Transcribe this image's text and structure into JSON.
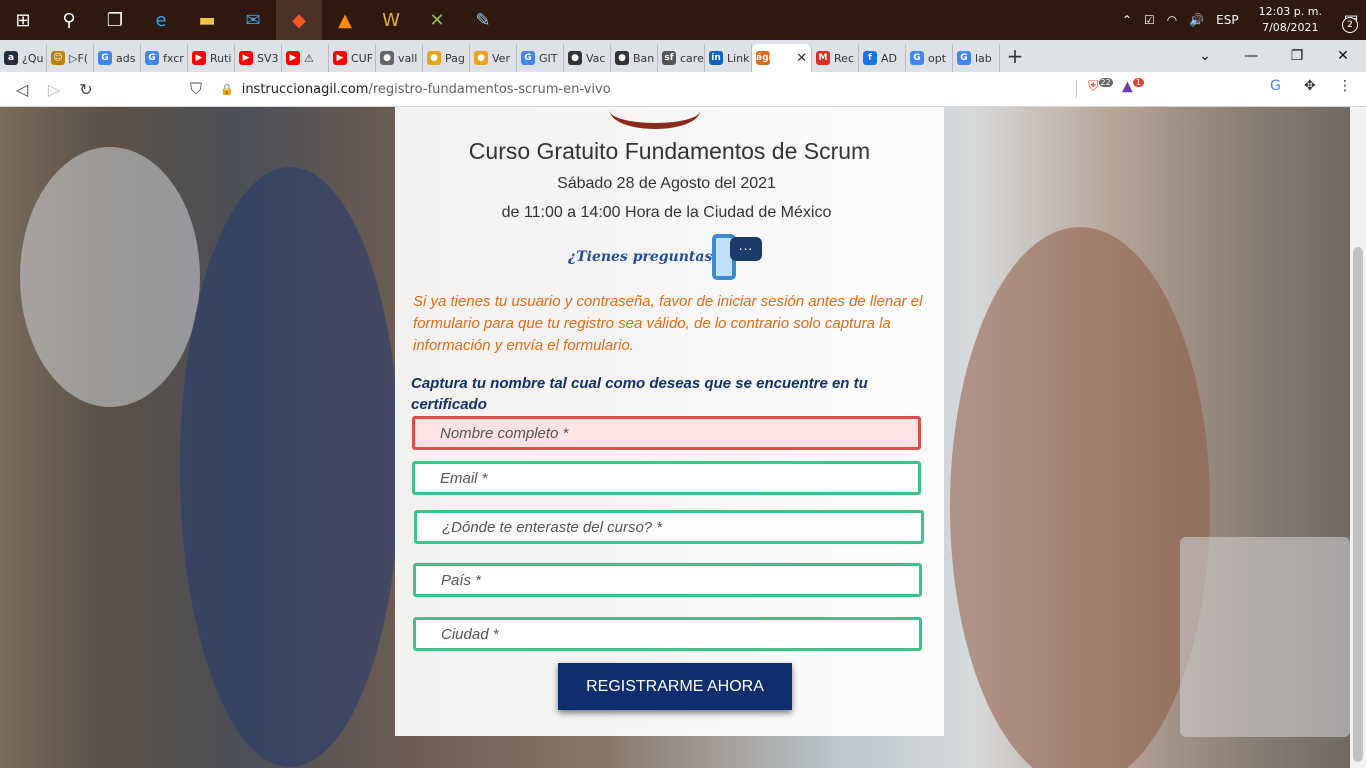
{
  "taskbar": {
    "items": [
      "start",
      "search",
      "task-view",
      "edge",
      "file-explorer",
      "mail",
      "brave",
      "vlc",
      "wow",
      "app-x",
      "paint"
    ],
    "tray": {
      "language": "ESP",
      "time": "12:03 p. m.",
      "date": "7/08/2021",
      "notifications": "2"
    }
  },
  "tabs": [
    {
      "label": "¿Qu",
      "fav": "a",
      "color": "#232f3e"
    },
    {
      "label": "▷F(",
      "fav": "☺",
      "color": "#b8860b"
    },
    {
      "label": "ads",
      "fav": "G",
      "color": "#4285f4"
    },
    {
      "label": "fxcr",
      "fav": "G",
      "color": "#4285f4"
    },
    {
      "label": "Ruti",
      "fav": "▶",
      "color": "#ff0000"
    },
    {
      "label": "SV3",
      "fav": "▶",
      "color": "#ff0000"
    },
    {
      "label": "⚠",
      "fav": "▶",
      "color": "#ff0000"
    },
    {
      "label": "CUF",
      "fav": "▶",
      "color": "#ff0000"
    },
    {
      "label": "vall",
      "fav": "●",
      "color": "#666666"
    },
    {
      "label": "Pag",
      "fav": "●",
      "color": "#e8a317"
    },
    {
      "label": "Ver",
      "fav": "●",
      "color": "#e8a317"
    },
    {
      "label": "GIT",
      "fav": "G",
      "color": "#4285f4"
    },
    {
      "label": "Vac",
      "fav": "●",
      "color": "#333333"
    },
    {
      "label": "Ban",
      "fav": "●",
      "color": "#333333"
    },
    {
      "label": "care",
      "fav": "sf",
      "color": "#555555"
    },
    {
      "label": "Link",
      "fav": "in",
      "color": "#0a66c2"
    },
    {
      "label": "",
      "fav": "ágil",
      "color": "#e46a17",
      "active": true
    },
    {
      "label": "Rec",
      "fav": "M",
      "color": "#d93025"
    },
    {
      "label": "AD",
      "fav": "f",
      "color": "#1a73e8"
    },
    {
      "label": "opt",
      "fav": "G",
      "color": "#4285f4"
    },
    {
      "label": "lab",
      "fav": "G",
      "color": "#4285f4"
    }
  ],
  "address": {
    "domain": "instruccionagil.com",
    "path": "/registro-fundamentos-scrum-en-vivo",
    "brave_count": "22",
    "alert_count": "1"
  },
  "page": {
    "title": "Curso Gratuito Fundamentos de Scrum",
    "date": "Sábado 28 de Agosto del 2021",
    "time": "de 11:00 a 14:00 Hora de la Ciudad de México",
    "questions": "¿Tienes preguntas?",
    "bubble": "...",
    "notice": "Si ya tienes tu usuario y contraseña, favor de iniciar sesión antes de llenar el formulario para que tu registro sea válido, de lo contrario solo captura la información y envía el formulario.",
    "capture_label": "Captura tu nombre tal cual como deseas que se encuentre en tu certificado",
    "fields": {
      "name": "Nombre completo *",
      "email": "Email *",
      "source": "¿Dónde te enteraste del curso? *",
      "country": "País *",
      "city": "Ciudad *"
    },
    "submit": "REGISTRARME AHORA"
  }
}
